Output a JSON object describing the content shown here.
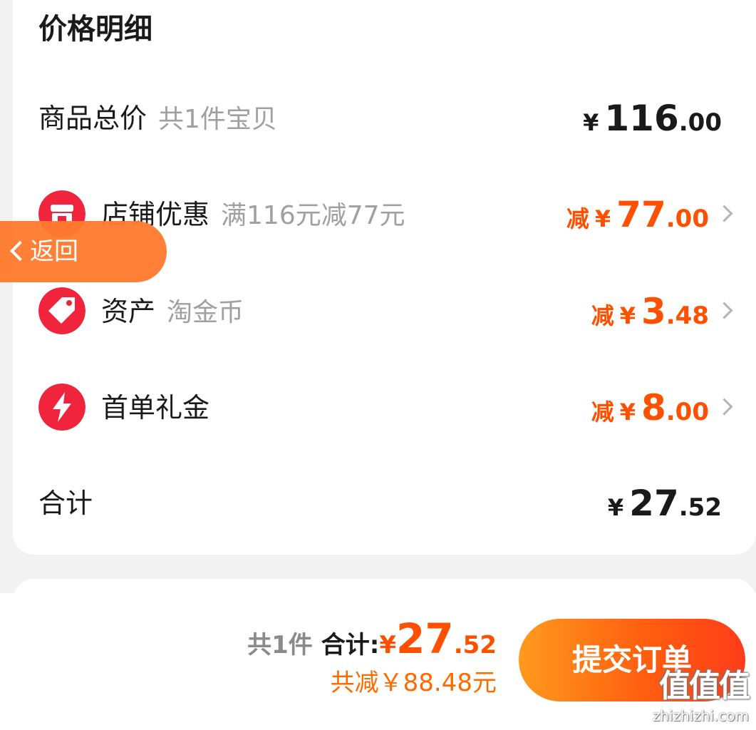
{
  "header": {
    "title": "价格明细"
  },
  "rows": [
    {
      "label": "商品总价",
      "sub": "共1件宝贝",
      "price": {
        "cur": "¥",
        "int": "116",
        "dec": ".00"
      }
    },
    {
      "label": "店铺优惠",
      "sub": "满116元减77元",
      "price": {
        "prefix": "减",
        "cur": "¥",
        "int": "77",
        "dec": ".00"
      }
    },
    {
      "label": "资产",
      "sub": "淘金币",
      "price": {
        "prefix": "减",
        "cur": "¥",
        "int": "3",
        "dec": ".48"
      }
    },
    {
      "label": "首单礼金",
      "sub": "",
      "price": {
        "prefix": "减",
        "cur": "¥",
        "int": "8",
        "dec": ".00"
      }
    },
    {
      "label": "合计",
      "sub": "",
      "price": {
        "cur": "¥",
        "int": "27",
        "dec": ".52"
      }
    }
  ],
  "back_button": {
    "label": "返回"
  },
  "footer": {
    "count": "共1件",
    "total_label": "合计:",
    "total": {
      "cur": "¥",
      "int": "27",
      "dec": ".52"
    },
    "saved": "共减￥88.48元",
    "submit_label": "提交订单"
  },
  "watermark": {
    "big": "值值值",
    "small": "zhizhizhi.com"
  },
  "icons": {
    "shop": "shop-discount-icon",
    "asset": "tag-icon",
    "gift": "lightning-icon"
  },
  "colors": {
    "accent": "#ff5000",
    "icon_red": "#f0243c",
    "back": "#ff7b2e"
  }
}
